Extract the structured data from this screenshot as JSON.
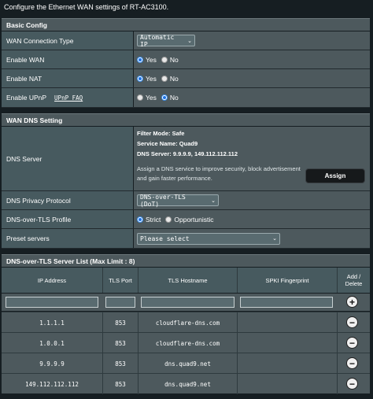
{
  "intro_text": "Configure the Ethernet WAN settings of RT-AC3100.",
  "basic_config": {
    "title": "Basic Config",
    "wan_connection_type": {
      "label": "WAN Connection Type",
      "value": "Automatic IP"
    },
    "enable_wan": {
      "label": "Enable WAN",
      "yes": "Yes",
      "no": "No",
      "selected": "Yes"
    },
    "enable_nat": {
      "label": "Enable NAT",
      "yes": "Yes",
      "no": "No",
      "selected": "Yes"
    },
    "enable_upnp": {
      "label": "Enable UPnP",
      "link": "UPnP FAQ",
      "yes": "Yes",
      "no": "No",
      "selected": "No"
    }
  },
  "wan_dns": {
    "title": "WAN DNS Setting",
    "dns_server": {
      "label": "DNS Server",
      "filter_mode": "Filter Mode: Safe",
      "service_name": "Service Name: Quad9",
      "dns_server_line": "DNS Server: 9.9.9.9, 149.112.112.112",
      "description": "Assign a DNS service to improve security, block advertisement and gain faster performance.",
      "assign_label": "Assign"
    },
    "privacy_protocol": {
      "label": "DNS Privacy Protocol",
      "value": "DNS-over-TLS (DoT)"
    },
    "dot_profile": {
      "label": "DNS-over-TLS Profile",
      "strict": "Strict",
      "opportunistic": "Opportunistic",
      "selected": "Strict"
    },
    "preset_servers": {
      "label": "Preset servers",
      "value": "Please select"
    }
  },
  "dot_list": {
    "title": "DNS-over-TLS Server List (Max Limit : 8)",
    "columns": [
      "IP Address",
      "TLS Port",
      "TLS Hostname",
      "SPKI Fingerprint",
      "Add / Delete"
    ],
    "rows": [
      {
        "ip": "1.1.1.1",
        "port": "853",
        "hostname": "cloudflare-dns.com",
        "spki": ""
      },
      {
        "ip": "1.0.0.1",
        "port": "853",
        "hostname": "cloudflare-dns.com",
        "spki": ""
      },
      {
        "ip": "9.9.9.9",
        "port": "853",
        "hostname": "dns.quad9.net",
        "spki": ""
      },
      {
        "ip": "149.112.112.112",
        "port": "853",
        "hostname": "dns.quad9.net",
        "spki": ""
      }
    ]
  }
}
